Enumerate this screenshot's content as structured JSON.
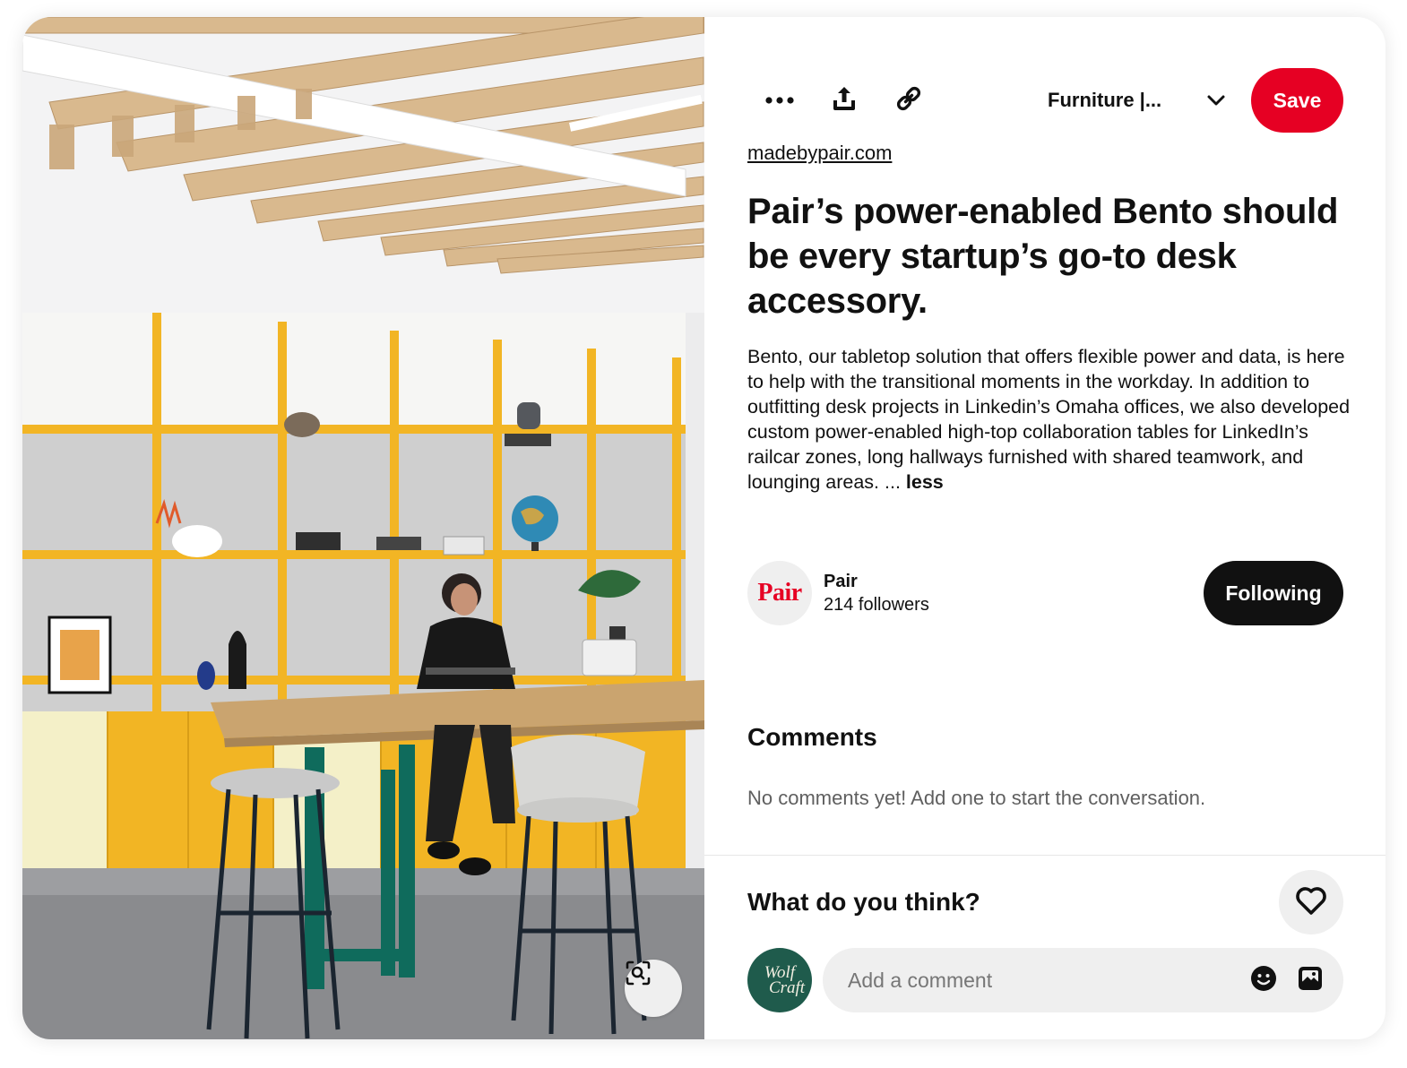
{
  "toolbar": {
    "more_icon": "more-horizontal-icon",
    "share_icon": "share-upload-icon",
    "link_icon": "link-icon",
    "board_name": "Furniture |...",
    "board_chevron_icon": "chevron-down-icon",
    "save_label": "Save"
  },
  "pin": {
    "source": "madebypair.com",
    "title": "Pair’s power-enabled Bento should be every startup’s go-to desk accessory.",
    "description": "Bento, our tabletop solution that offers flexible power and data, is here to help with the transitional moments in the workday. In addition to outfitting desk projects in Linkedin’s Omaha offices, we also developed custom power-enabled high-top collaboration tables for LinkedIn’s railcar zones, long hallways furnished with shared teamwork, and lounging areas. ...",
    "less_label": "less"
  },
  "creator": {
    "avatar_text": "Pair",
    "name": "Pair",
    "followers": "214 followers",
    "follow_label": "Following"
  },
  "comments": {
    "heading": "Comments",
    "empty_text": "No comments yet! Add one to start the conversation."
  },
  "composer": {
    "prompt": "What do you think?",
    "heart_icon": "heart-icon",
    "user_avatar_line1": "Wolf",
    "user_avatar_line2": "Craft",
    "placeholder": "Add a comment",
    "emoji_icon": "emoji-smile-icon",
    "photo_icon": "image-attach-icon"
  },
  "image": {
    "lens_icon": "visual-search-icon"
  },
  "colors": {
    "brand_red": "#e60023",
    "following_bg": "#111111",
    "shelf_yellow": "#f2b524",
    "table_green": "#0f6b5c"
  }
}
